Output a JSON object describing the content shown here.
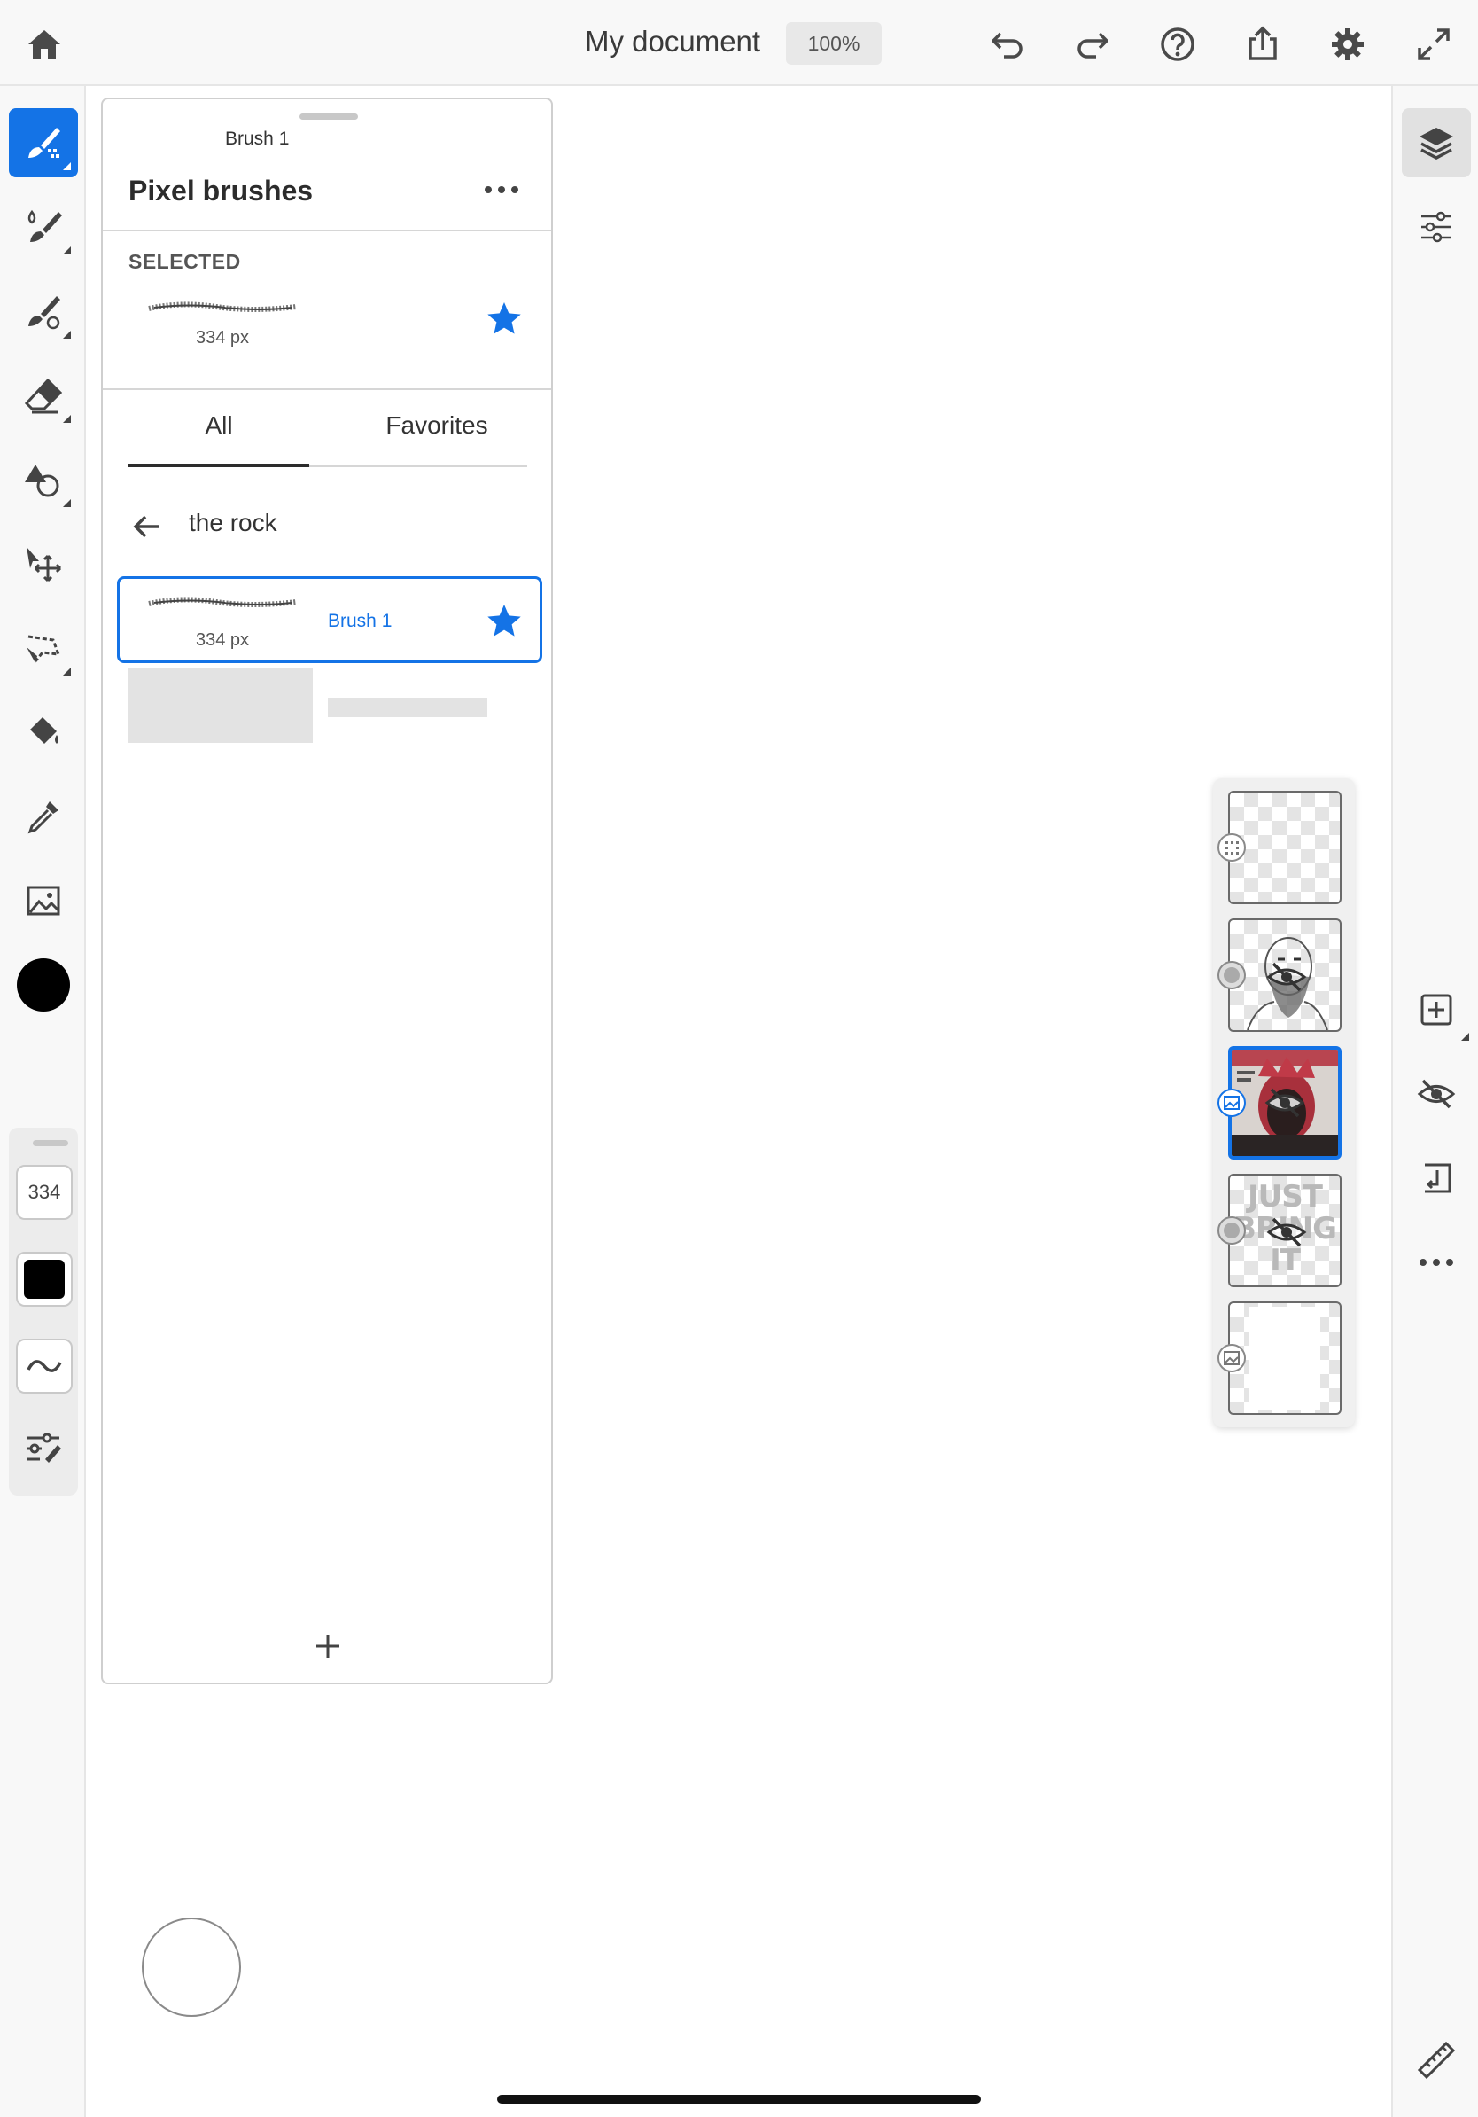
{
  "header": {
    "doc_title": "My document",
    "zoom": "100%",
    "icons": [
      "home-icon",
      "undo-icon",
      "redo-icon",
      "help-icon",
      "share-icon",
      "settings-icon",
      "fullscreen-icon"
    ]
  },
  "left_toolbar": {
    "tools": [
      "pixel-brush-icon",
      "live-brush-icon",
      "vector-brush-icon",
      "eraser-icon",
      "shape-icon",
      "move-icon",
      "lasso-select-icon",
      "paint-bucket-icon",
      "eyedropper-icon",
      "image-icon"
    ],
    "active_tool": "pixel-brush-icon",
    "color": "#000000",
    "brush_size": "334",
    "brush_color": "#000000"
  },
  "brush_panel": {
    "title": "Pixel brushes",
    "selected_label": "SELECTED",
    "selected_brush": {
      "name": "Brush 1",
      "size": "334 px",
      "favorite": true
    },
    "tabs": [
      "All",
      "Favorites"
    ],
    "active_tab": "All",
    "search_query": "the rock",
    "results": [
      {
        "name": "Brush 1",
        "size": "334 px",
        "favorite": true
      }
    ]
  },
  "layers": {
    "items": [
      {
        "kind": "pixel",
        "visible": true,
        "selected": false
      },
      {
        "kind": "pixel",
        "visible": false,
        "selected": false
      },
      {
        "kind": "image",
        "visible": false,
        "selected": true
      },
      {
        "kind": "text",
        "visible": false,
        "selected": false,
        "text_lines": [
          "JUST",
          "BRING",
          "IT"
        ]
      },
      {
        "kind": "image",
        "visible": true,
        "selected": false
      }
    ]
  },
  "right_toolbar": {
    "icons": [
      "layers-icon",
      "layer-properties-icon",
      "add-layer-icon",
      "hide-layer-icon",
      "merge-down-icon",
      "more-icon",
      "ruler-icon"
    ]
  },
  "colors": {
    "accent": "#1473e6",
    "toolbar_bg": "#f8f8f8",
    "star": "#1473e6"
  }
}
